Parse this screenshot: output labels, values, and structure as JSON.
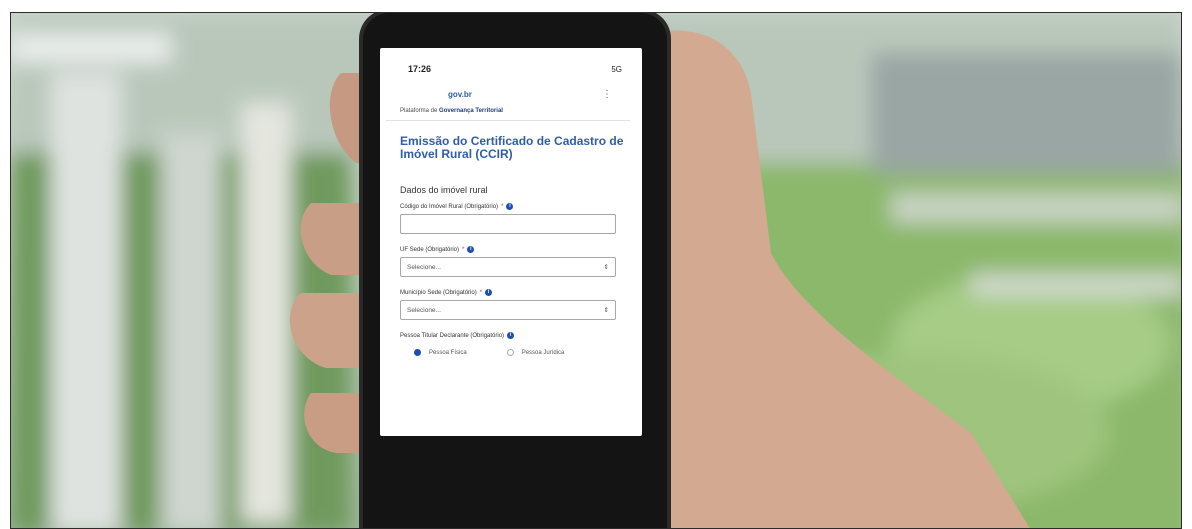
{
  "status_bar": {
    "time": "17:26",
    "signal": "5G"
  },
  "app_bar": {
    "logo_text": "gov.br",
    "menu_icon": "menu-dots-icon"
  },
  "platform_text_prefix": "Plataforma de ",
  "platform_text_bold": "Governança Territorial",
  "page_title": "Emissão do Certificado de Cadastro de Imóvel Rural (CCIR)",
  "section_title": "Dados do imóvel rural",
  "fields": {
    "codigo": {
      "label": "Código do Imóvel Rural (Obrigatório)",
      "required": "*",
      "value": ""
    },
    "uf": {
      "label": "UF Sede (Obrigatório)",
      "required": "*",
      "value": "Selecione..."
    },
    "municipio": {
      "label": "Município Sede (Obrigatório)",
      "required": "*",
      "value": "Selecione..."
    },
    "pessoa": {
      "label": "Pessoa Titular Declarante (Obrigatório)",
      "options": [
        "Pessoa Física",
        "Pessoa Jurídica"
      ],
      "selected": "Pessoa Física"
    }
  },
  "colors": {
    "accent": "#2f5dab",
    "radio_selected": "#1d4fae"
  }
}
